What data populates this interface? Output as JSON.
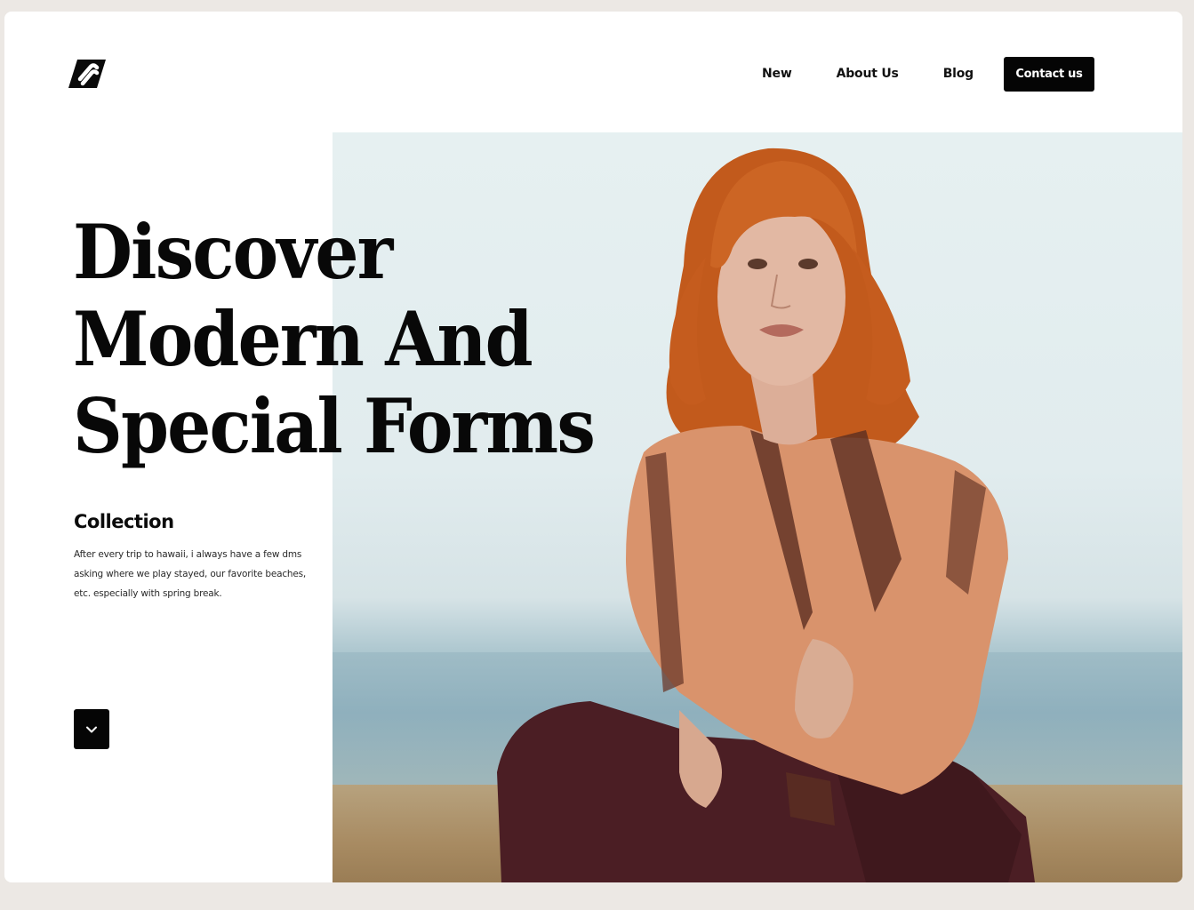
{
  "header": {
    "logo_icon": "link-logo-icon",
    "nav": [
      {
        "label": "New"
      },
      {
        "label": "About Us"
      },
      {
        "label": "Blog"
      }
    ],
    "contact_label": "Contact us"
  },
  "hero": {
    "headline_lines": [
      "Discover",
      "Modern And",
      "Special Forms"
    ],
    "image_icon": "portrait-photo",
    "collection": {
      "title": "Collection",
      "description": "After every trip to hawaii, i always have a few dms asking where we play stayed, our favorite beaches, etc. especially with spring break."
    },
    "scroll_icon": "chevron-down-icon"
  },
  "colors": {
    "accent": "#050505",
    "background": "#ece8e4",
    "card": "#ffffff"
  }
}
